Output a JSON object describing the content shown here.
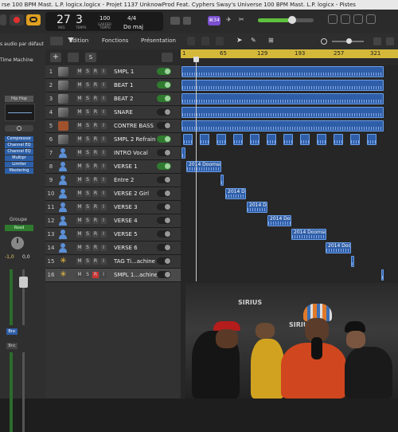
{
  "window": {
    "title": "rse 100 BPM Mast. L.P. logicx.logicx - Projet 1137 UnknowProd Feat. Cyphers Sway's Universe 100 BPM Mast. L.P. logicx - Pistes"
  },
  "control_bar": {
    "lcd": {
      "bar": "27",
      "beat": "3",
      "bar_label": "MES",
      "beat_label": "TEMPS",
      "tempo": "100",
      "tempo_label": "GARDER",
      "tempo_sub": "TEMPO",
      "signature": "4/4",
      "key": "Do maj"
    },
    "badge": "⌘34"
  },
  "left_pane": {
    "audio_default": "s audio par défaut",
    "time_machine": "Time Machine",
    "preset": "Hip Hop",
    "plugins": [
      "Compressor",
      "Channel EQ",
      "Channel EQ",
      "Multipr",
      "Limiter",
      "Mastering"
    ],
    "group_label": "Groupe",
    "read_label": "Read",
    "pan_left": "-1,0",
    "pan_right": "0,0",
    "bounce": "Bnc",
    "bounce2": "Bnc"
  },
  "toolbar": {
    "edition": "Édition",
    "functions": "Fonctions",
    "presentation": "Présentation"
  },
  "ruler": {
    "marks": [
      "1",
      "65",
      "129",
      "193",
      "257",
      "321"
    ]
  },
  "tracks": [
    {
      "num": "1",
      "icon": "photo-icon",
      "name": "SMPL 1",
      "knob": "on"
    },
    {
      "num": "2",
      "icon": "photo-icon",
      "name": "BEAT 1",
      "knob": "on"
    },
    {
      "num": "3",
      "icon": "photo-icon",
      "name": "BEAT 2",
      "knob": "on"
    },
    {
      "num": "4",
      "icon": "photo-icon",
      "name": "SNARE",
      "knob": "off"
    },
    {
      "num": "5",
      "icon": "bass-icon",
      "name": "CONTRE BASS",
      "knob": "off"
    },
    {
      "num": "6",
      "icon": "photo-icon",
      "name": "SMPL 2 Refrain",
      "knob": "on"
    },
    {
      "num": "7",
      "icon": "person-icon",
      "name": "INTRO Vocal",
      "knob": "off"
    },
    {
      "num": "8",
      "icon": "person-icon",
      "name": "VERSE  1",
      "knob": "on"
    },
    {
      "num": "9",
      "icon": "person-icon",
      "name": "Entre 2",
      "knob": "off"
    },
    {
      "num": "10",
      "icon": "person-icon",
      "name": "VERSE  2 Girl",
      "knob": "off"
    },
    {
      "num": "11",
      "icon": "person-icon",
      "name": "VERSE  3",
      "knob": "off"
    },
    {
      "num": "12",
      "icon": "person-icon",
      "name": "VERSE  4",
      "knob": "off"
    },
    {
      "num": "13",
      "icon": "person-icon",
      "name": "VERSE  5",
      "knob": "off"
    },
    {
      "num": "14",
      "icon": "person-icon",
      "name": "VERSE  6",
      "knob": "off"
    },
    {
      "num": "15",
      "icon": "star-icon",
      "name": "TAG Ti...achine",
      "knob": "off"
    },
    {
      "num": "16",
      "icon": "star-icon",
      "name": "SMPL 1...achine",
      "knob": "off",
      "selected": true
    }
  ],
  "regions": {
    "verse1": "2014 Doomsda",
    "verse2": "2014 Do",
    "verse3": "2014 Doo",
    "verse4": "2014 Doo",
    "verse5": "2014 Doomsda",
    "verse6": "2014 Doo"
  },
  "video": {
    "sign": "SIRIUS",
    "sign2": "SIRIUS"
  }
}
